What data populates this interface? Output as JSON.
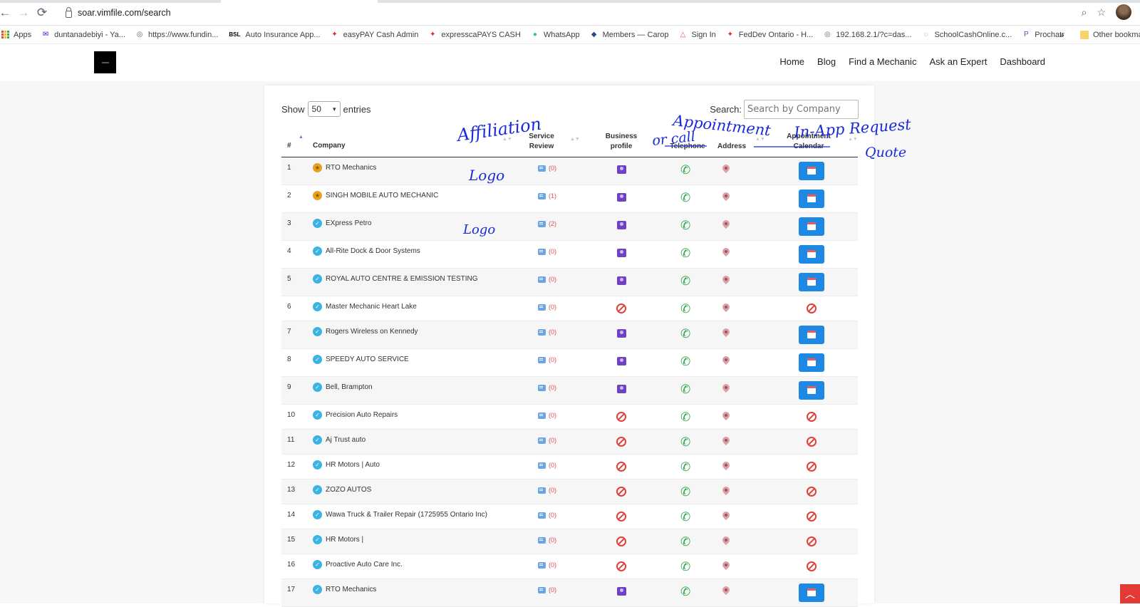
{
  "browser": {
    "url": "soar.vimfile.com/search",
    "bookmarks": [
      {
        "label": "Apps",
        "icon": "apps-grid-icon"
      },
      {
        "label": "duntanadebiyi - Ya...",
        "icon": "yahoo-mail-icon"
      },
      {
        "label": "https://www.fundin...",
        "icon": "globe-icon"
      },
      {
        "label": "Auto Insurance App...",
        "icon": "bsl-icon",
        "icon_text": "BSL"
      },
      {
        "label": "easyPAY Cash Admin",
        "icon": "maple-leaf-icon"
      },
      {
        "label": "expresscaPAYS CASH",
        "icon": "maple-leaf-icon"
      },
      {
        "label": "WhatsApp",
        "icon": "whatsapp-icon"
      },
      {
        "label": "Members — Carop",
        "icon": "diamond-icon"
      },
      {
        "label": "Sign In",
        "icon": "triangle-icon"
      },
      {
        "label": "FedDev Ontario - H...",
        "icon": "maple-leaf-icon"
      },
      {
        "label": "192.168.2.1/?c=das...",
        "icon": "globe-icon"
      },
      {
        "label": "SchoolCashOnline.c...",
        "icon": "swirl-icon"
      },
      {
        "label": "Prochatr",
        "icon": "p-icon"
      }
    ],
    "more": "»",
    "other_bookmarks": "Other bookma"
  },
  "site": {
    "nav": [
      "Home",
      "Blog",
      "Find a Mechanic",
      "Ask an Expert",
      "Dashboard"
    ]
  },
  "table_controls": {
    "show_label": "Show",
    "entries_value": "50",
    "entries_label": "entries",
    "search_label": "Search:",
    "search_placeholder": "Search by Company"
  },
  "columns": {
    "num": "#",
    "company": "Company",
    "service_review_1": "Service",
    "service_review_2": "Review",
    "business_profile_1": "Business",
    "business_profile_2": "profile",
    "telephone": "Telephone",
    "address": "Address",
    "appointment_1": "Appointment",
    "appointment_2": "Calendar"
  },
  "rows": [
    {
      "num": "1",
      "company": "RTO Mechanics",
      "badge": "gold",
      "reviews": "(0)",
      "profile": true,
      "calendar": true
    },
    {
      "num": "2",
      "company": "SINGH MOBILE AUTO MECHANIC",
      "badge": "gold",
      "reviews": "(1)",
      "profile": true,
      "calendar": true
    },
    {
      "num": "3",
      "company": "EXpress Petro",
      "badge": "check",
      "reviews": "(2)",
      "profile": true,
      "calendar": true
    },
    {
      "num": "4",
      "company": "All-Rite Dock & Door Systems",
      "badge": "check",
      "reviews": "(0)",
      "profile": true,
      "calendar": true
    },
    {
      "num": "5",
      "company": "ROYAL AUTO CENTRE & EMISSION TESTING",
      "badge": "check",
      "reviews": "(0)",
      "profile": true,
      "calendar": true
    },
    {
      "num": "6",
      "company": "Master Mechanic Heart Lake",
      "badge": "check",
      "reviews": "(0)",
      "profile": false,
      "calendar": false
    },
    {
      "num": "7",
      "company": "Rogers Wireless on Kennedy",
      "badge": "check",
      "reviews": "(0)",
      "profile": true,
      "calendar": true
    },
    {
      "num": "8",
      "company": "SPEEDY AUTO SERVICE",
      "badge": "check",
      "reviews": "(0)",
      "profile": true,
      "calendar": true
    },
    {
      "num": "9",
      "company": "Bell, Brampton",
      "badge": "check",
      "reviews": "(0)",
      "profile": true,
      "calendar": true
    },
    {
      "num": "10",
      "company": "Precision Auto Repairs",
      "badge": "check",
      "reviews": "(0)",
      "profile": false,
      "calendar": false
    },
    {
      "num": "11",
      "company": "Aj Trust auto",
      "badge": "check",
      "reviews": "(0)",
      "profile": false,
      "calendar": false
    },
    {
      "num": "12",
      "company": "HR Motors | Auto",
      "badge": "check",
      "reviews": "(0)",
      "profile": false,
      "calendar": false
    },
    {
      "num": "13",
      "company": "ZOZO AUTOS",
      "badge": "check",
      "reviews": "(0)",
      "profile": false,
      "calendar": false
    },
    {
      "num": "14",
      "company": "Wawa Truck & Trailer Repair (1725955 Ontario Inc)",
      "badge": "check",
      "reviews": "(0)",
      "profile": false,
      "calendar": false
    },
    {
      "num": "15",
      "company": "HR Motors |",
      "badge": "check",
      "reviews": "(0)",
      "profile": false,
      "calendar": false
    },
    {
      "num": "16",
      "company": "Proactive Auto Care Inc.",
      "badge": "check",
      "reviews": "(0)",
      "profile": false,
      "calendar": false
    },
    {
      "num": "17",
      "company": "RTO Mechanics",
      "badge": "check",
      "reviews": "(0)",
      "profile": true,
      "calendar": true
    }
  ],
  "annotations": {
    "affiliation": "Affiliation",
    "logo_1": "Logo",
    "logo_2": "Logo",
    "appointment": "Appointment",
    "or_call": "or call",
    "in_app_request": "In-App Request",
    "quote": "Quote"
  },
  "colors": {
    "calendar_button": "#1e88e5",
    "profile_icon": "#6f42c1",
    "phone_icon": "#2fa34b",
    "not_available": "#e0403a",
    "handwriting_ink": "#1a2ad8",
    "scroll_top": "#e53935"
  }
}
